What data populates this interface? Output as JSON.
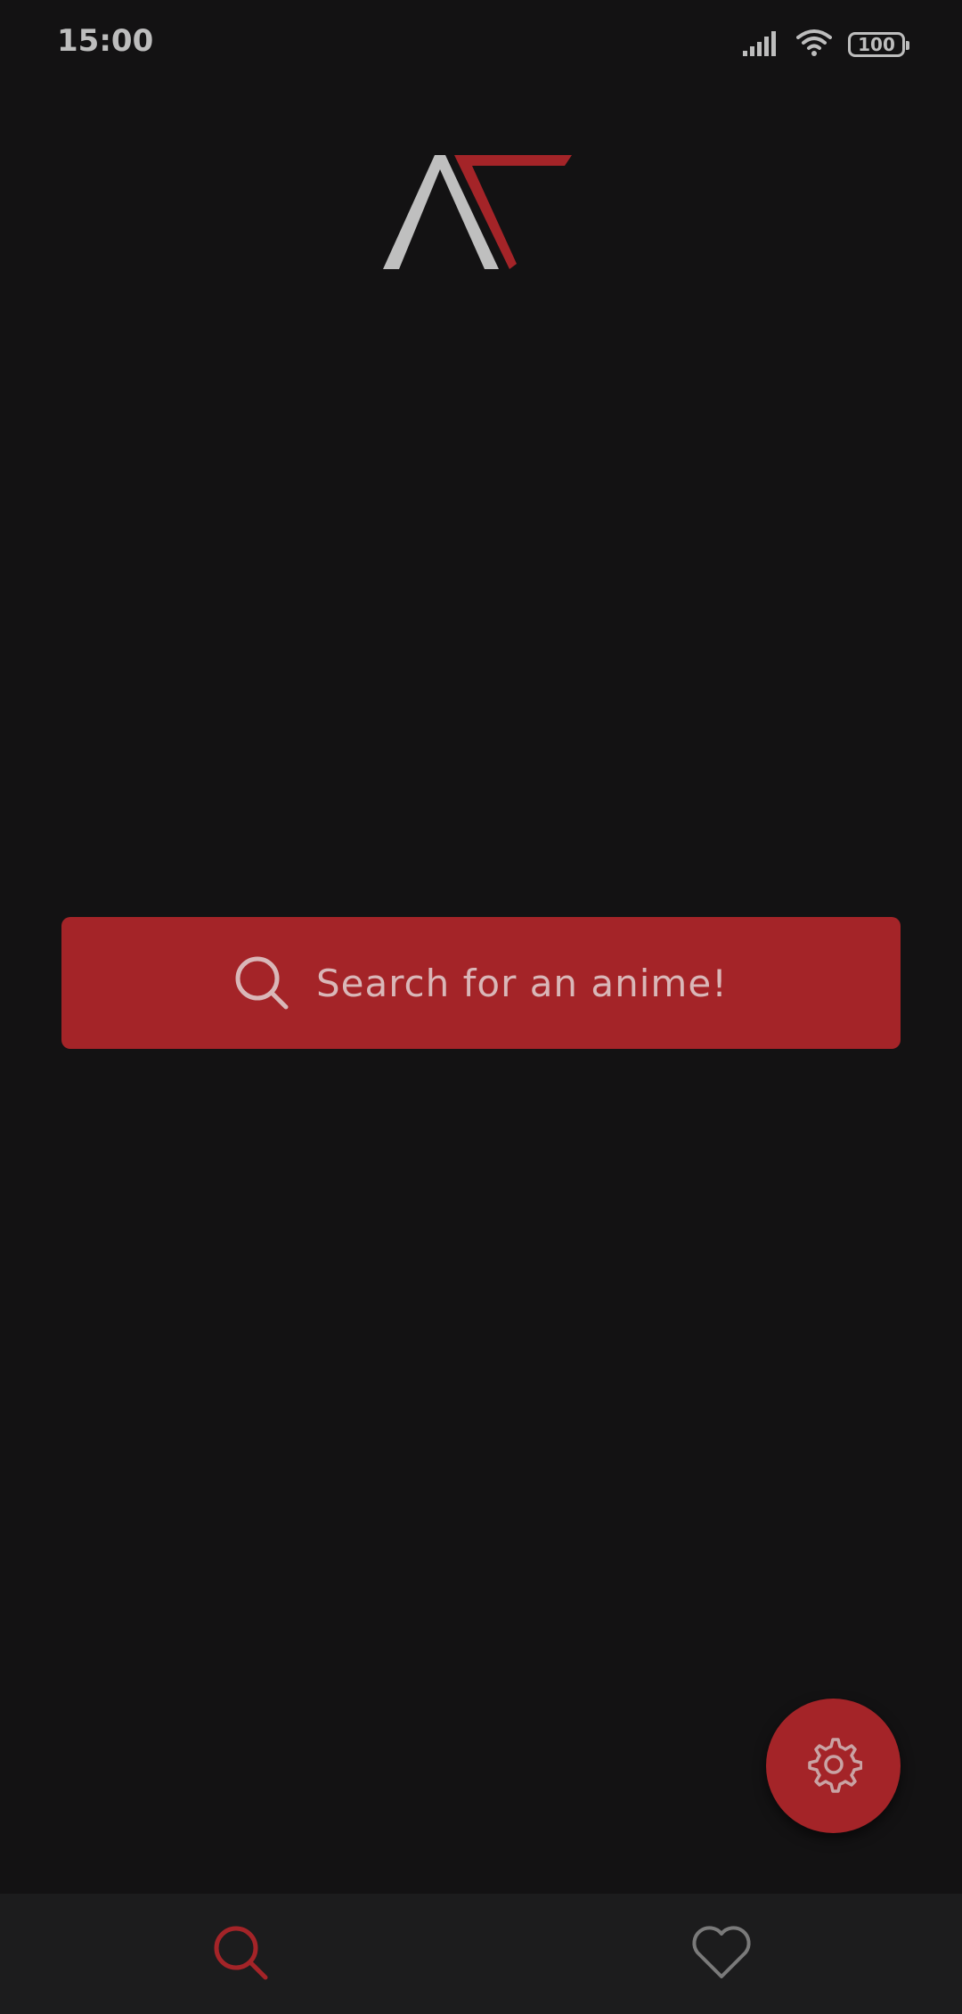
{
  "status_bar": {
    "time": "15:00",
    "battery": "100",
    "icons": [
      "signal-icon",
      "wifi-icon",
      "battery-icon"
    ]
  },
  "logo": {
    "name": "app-logo"
  },
  "search": {
    "label": "Search for an anime!",
    "icon": "search-icon"
  },
  "fab": {
    "icon": "gear-icon"
  },
  "bottom_nav": {
    "items": [
      {
        "icon": "search-icon",
        "active": true
      },
      {
        "icon": "heart-icon",
        "active": false
      }
    ]
  },
  "colors": {
    "background": "#131213",
    "accent": "#a42428",
    "nav_background": "#1c1c1d",
    "text_muted": "#bdbdbd"
  }
}
